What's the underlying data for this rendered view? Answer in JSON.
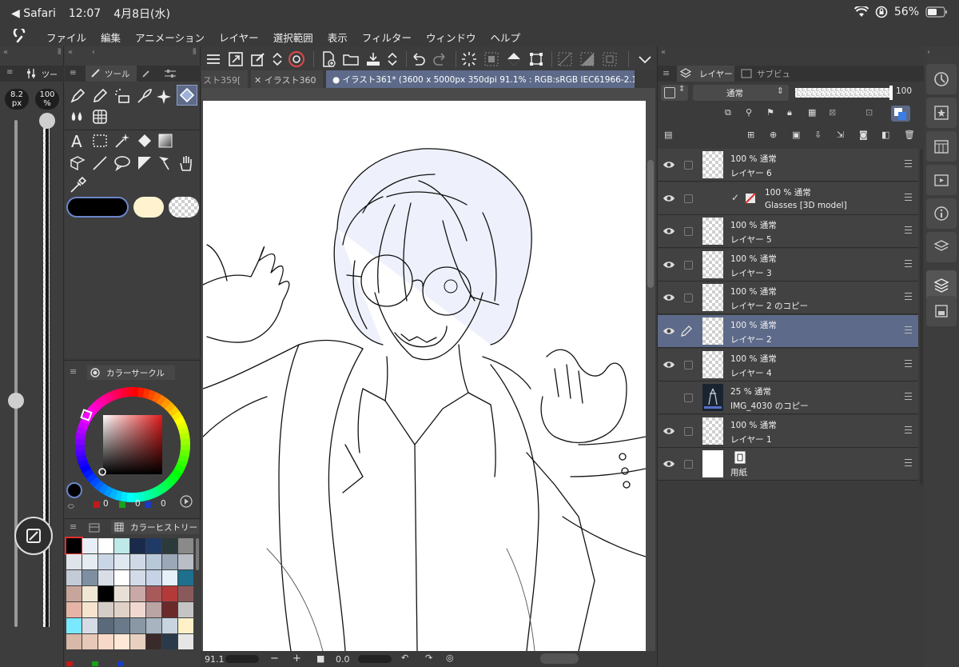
{
  "status": {
    "back_app": "Safari",
    "time": "12:07",
    "date": "4月8日(水)",
    "battery": "56%"
  },
  "menu": [
    "ファイル",
    "編集",
    "アニメーション",
    "レイヤー",
    "選択範囲",
    "表示",
    "フィルター",
    "ウィンドウ",
    "ヘルプ"
  ],
  "left": {
    "brush_size": "8.2",
    "brush_unit": "px",
    "opacity": "100",
    "opacity_unit": "%",
    "opacity_level": 1.0,
    "size_level": 0.45
  },
  "tool_panel": {
    "tab1": "ツー",
    "tab2": "ツール"
  },
  "color_panel": {
    "title": "カラーサークル",
    "r": "0",
    "g": "0",
    "b": "0"
  },
  "history_panel": {
    "title": "カラーヒストリー",
    "swatches": [
      "#000000",
      "#e8eef6",
      "#ffffff",
      "#bfe8e8",
      "#1a2a4a",
      "#1f3a66",
      "#2b3a3a",
      "#8a8a8a",
      "#dfe3ea",
      "#e5edf3",
      "#c9d6e6",
      "#dfe8f0",
      "#cfd9e6",
      "#b7c8d8",
      "#9aa8b8",
      "#b9bec6",
      "#c3cbd6",
      "#7e8fa2",
      "#d8dde6",
      "#ffffff",
      "#d3dbe8",
      "#c6d3e6",
      "#e6f0f8",
      "#1f6f8f",
      "#c8a59a",
      "#efe6d4",
      "#000000",
      "#e8e0d6",
      "#c9a8a8",
      "#a85a5a",
      "#b43a3a",
      "#8a5a5a",
      "#e6b4a6",
      "#f6e4cf",
      "#d4ccc6",
      "#e0d2c6",
      "#f0d8d0",
      "#bba4a4",
      "#6b2a2a",
      "#c4c4c4",
      "#7ae8ff",
      "#d6dbe6",
      "#5a6a7a",
      "#6a7a8a",
      "#8a98a6",
      "#a8b4c0",
      "#c8d4e0",
      "#fff0c8",
      "#d8b8a8",
      "#e8c8b8",
      "#f8d8c8",
      "#ffe8d8",
      "#e8d0c0",
      "#3a2a2a",
      "#2a3a4a",
      "#e6e6e6"
    ]
  },
  "command_tabs": {
    "tab_prev": "スト359[",
    "tab_mid": "イラスト360",
    "tab_active": "イラスト361* (3600 x 5000px 350dpi 91.1% : RGB:sRGB IEC61966-2.1)"
  },
  "canvas_status": {
    "zoom": "91.1",
    "angle": "0.0"
  },
  "layer_panel": {
    "tab_layer": "レイヤー",
    "tab_sub": "サブビュー",
    "blend_mode": "通常",
    "opacity": "100",
    "layers": [
      {
        "pct": "100 %",
        "mode": "通常",
        "name": "レイヤー 6",
        "visible": true,
        "selected": false,
        "kind": "raster"
      },
      {
        "pct": "100 %",
        "mode": "通常",
        "name": "Glasses [3D model]",
        "visible": true,
        "selected": false,
        "kind": "3d"
      },
      {
        "pct": "100 %",
        "mode": "通常",
        "name": "レイヤー 5",
        "visible": true,
        "selected": false,
        "kind": "raster"
      },
      {
        "pct": "100 %",
        "mode": "通常",
        "name": "レイヤー 3",
        "visible": true,
        "selected": false,
        "kind": "raster"
      },
      {
        "pct": "100 %",
        "mode": "通常",
        "name": "レイヤー 2 のコピー",
        "visible": true,
        "selected": false,
        "kind": "raster"
      },
      {
        "pct": "100 %",
        "mode": "通常",
        "name": "レイヤー 2",
        "visible": true,
        "selected": true,
        "kind": "raster"
      },
      {
        "pct": "100 %",
        "mode": "通常",
        "name": "レイヤー 4",
        "visible": true,
        "selected": false,
        "kind": "raster"
      },
      {
        "pct": "25 %",
        "mode": "通常",
        "name": "IMG_4030 のコピー",
        "visible": false,
        "selected": false,
        "kind": "image"
      },
      {
        "pct": "100 %",
        "mode": "通常",
        "name": "レイヤー 1",
        "visible": true,
        "selected": false,
        "kind": "raster"
      },
      {
        "pct": "",
        "mode": "",
        "name": "用紙",
        "visible": true,
        "selected": false,
        "kind": "paper"
      }
    ]
  }
}
